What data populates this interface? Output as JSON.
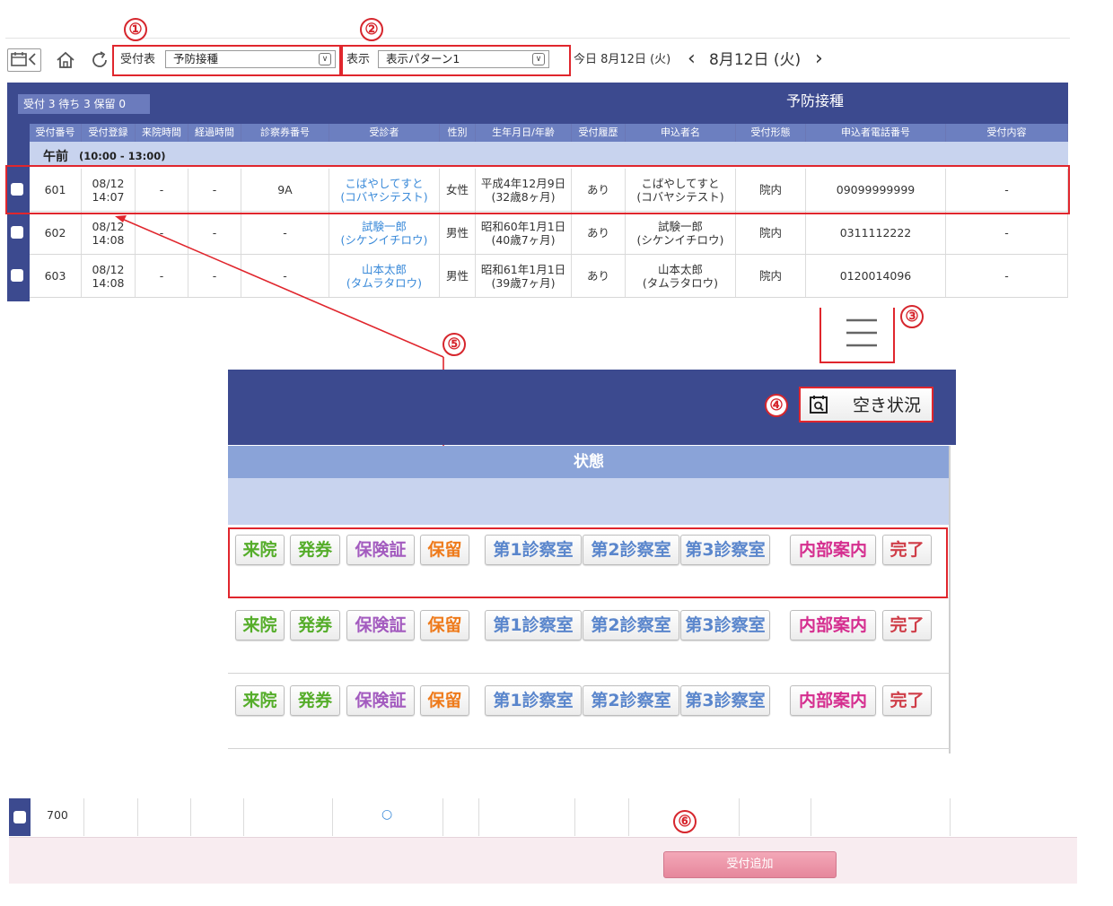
{
  "markers": [
    "①",
    "②",
    "③",
    "④",
    "⑤",
    "⑥"
  ],
  "toolbar": {
    "back_icon": "calendar-back-icon",
    "home_icon": "home-icon",
    "refresh_icon": "refresh-icon",
    "reception_label": "受付表",
    "reception_value": "予防接種",
    "display_label": "表示",
    "display_value": "表示パターン1",
    "today_label": "今日 8月12日 (火)",
    "prev": "‹",
    "date": "8月12日 (火)",
    "next": "›"
  },
  "summary": {
    "counts": "受付 3 待ち 3 保留 0",
    "title": "予防接種"
  },
  "columns": [
    "受付番号",
    "受付登録",
    "来院時間",
    "経過時間",
    "診察券番号",
    "受診者",
    "性別",
    "生年月日/年齢",
    "受付履歴",
    "申込者名",
    "受付形態",
    "申込者電話番号",
    "受付内容"
  ],
  "section": {
    "label": "午前",
    "time": "(10:00 - 13:00)"
  },
  "rows": [
    {
      "no": "601",
      "date": "08/12",
      "time": "14:07",
      "visit": "-",
      "elapsed": "-",
      "card": "9A",
      "name": "こばやしてすと",
      "kana": "(コバヤシテスト)",
      "sex": "女性",
      "birth": "平成4年12月9日",
      "age": "(32歳8ヶ月)",
      "history": "あり",
      "applicant": "こばやしてすと",
      "applicant_kana": "(コバヤシテスト)",
      "form": "院内",
      "phone": "09099999999",
      "content": "-"
    },
    {
      "no": "602",
      "date": "08/12",
      "time": "14:08",
      "visit": "-",
      "elapsed": "-",
      "card": "-",
      "name": "試験一郎",
      "kana": "(シケンイチロウ)",
      "sex": "男性",
      "birth": "昭和60年1月1日",
      "age": "(40歳7ヶ月)",
      "history": "あり",
      "applicant": "試験一郎",
      "applicant_kana": "(シケンイチロウ)",
      "form": "院内",
      "phone": "0311112222",
      "content": "-"
    },
    {
      "no": "603",
      "date": "08/12",
      "time": "14:08",
      "visit": "-",
      "elapsed": "-",
      "card": "-",
      "name": "山本太郎",
      "kana": "(タムラタロウ)",
      "sex": "男性",
      "birth": "昭和61年1月1日",
      "age": "(39歳7ヶ月)",
      "history": "あり",
      "applicant": "山本太郎",
      "applicant_kana": "(タムラタロウ)",
      "form": "院内",
      "phone": "0120014096",
      "content": "-"
    }
  ],
  "menu_icon": "hamburger-menu-icon",
  "availability": {
    "icon": "calendar-search-icon",
    "label": "空き状況"
  },
  "status_header": "状態",
  "status_buttons": [
    "来院",
    "発券",
    "保険証",
    "保留",
    "第1診察室",
    "第2診察室",
    "第3診察室",
    "内部案内",
    "完了"
  ],
  "bottom_row": {
    "no": "700",
    "mark": "○"
  },
  "add_button": "受付追加",
  "colors": {
    "navy": "#3c4a8f",
    "header_blue": "#6c7fc0",
    "section_blue": "#c8d3ee",
    "annotation_red": "#e0262d",
    "add_button": "#ec8fa4"
  }
}
